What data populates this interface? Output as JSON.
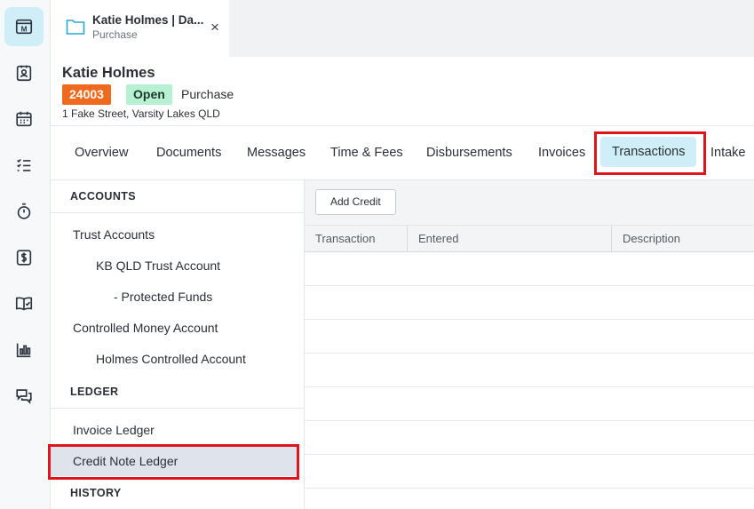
{
  "rail": {
    "items": [
      {
        "icon": "matter-logo-icon"
      },
      {
        "icon": "contact-card-icon"
      },
      {
        "icon": "calendar-icon"
      },
      {
        "icon": "checklist-icon"
      },
      {
        "icon": "stopwatch-icon"
      },
      {
        "icon": "dollar-icon"
      },
      {
        "icon": "book-check-icon"
      },
      {
        "icon": "bar-chart-icon"
      },
      {
        "icon": "chat-icon"
      }
    ],
    "logo_letter": "M"
  },
  "tab": {
    "title": "Katie Holmes | Da...",
    "subtitle": "Purchase",
    "close": "×"
  },
  "matter": {
    "name": "Katie Holmes",
    "number": "24003",
    "status": "Open",
    "type": "Purchase",
    "address": "1 Fake Street, Varsity Lakes QLD"
  },
  "nav": {
    "tabs": [
      "Overview",
      "Documents",
      "Messages",
      "Time & Fees",
      "Disbursements",
      "Invoices",
      "Transactions",
      "Intake"
    ],
    "active": "Transactions"
  },
  "accounts": {
    "heading": "ACCOUNTS",
    "trust": "Trust Accounts",
    "trust_sub": "KB QLD Trust Account",
    "trust_sub2": "- Protected Funds",
    "controlled": "Controlled Money Account",
    "controlled_sub": "Holmes Controlled Account"
  },
  "ledger": {
    "heading": "LEDGER",
    "invoice": "Invoice Ledger",
    "credit": "Credit Note Ledger"
  },
  "history": {
    "heading": "HISTORY"
  },
  "transactions": {
    "add_credit": "Add Credit",
    "columns": [
      "Transaction",
      "Entered",
      "Description"
    ]
  },
  "colors": {
    "accent": "#cfeef7",
    "badge_number": "#ef6a1f",
    "badge_open": "#b7f0d2",
    "highlight": "#e0141e"
  }
}
